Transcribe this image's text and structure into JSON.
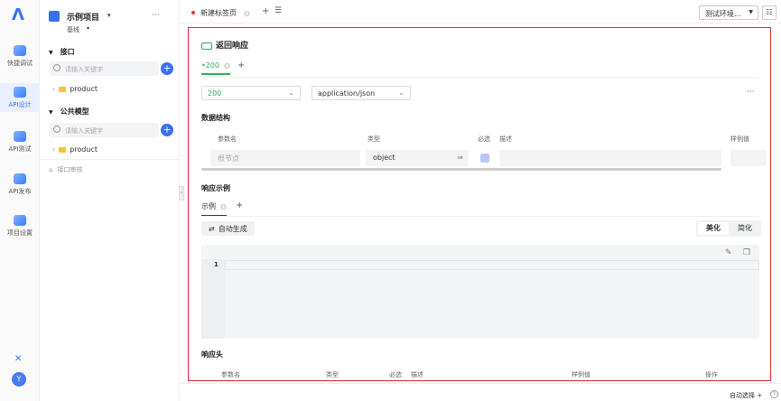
{
  "rail": {
    "items": [
      {
        "label": "快捷调试",
        "icon": "bolt-icon"
      },
      {
        "label": "API设计",
        "icon": "design-icon"
      },
      {
        "label": "API测试",
        "icon": "test-icon"
      },
      {
        "label": "API发布",
        "icon": "publish-icon"
      },
      {
        "label": "项目设置",
        "icon": "settings-icon"
      }
    ],
    "avatar": "Y"
  },
  "sidebar": {
    "project": "示例项目",
    "branch": "基线",
    "more": "···",
    "sections": [
      {
        "title": "接口",
        "placeholder": "请输入关键字",
        "tree_item": "product"
      },
      {
        "title": "公共模型",
        "placeholder": "请输入关键字",
        "tree_item": "product"
      }
    ],
    "review": "接口审核"
  },
  "topbar": {
    "tab": "新建标签页",
    "env": "测试环境..."
  },
  "panel": {
    "title": "返回响应",
    "status_tab": "200",
    "status_select": "200",
    "content_type": "application/json",
    "more": "···",
    "schema_title": "数据结构",
    "headers": [
      "参数名",
      "类型",
      "必选",
      "描述",
      "样例值"
    ],
    "row": {
      "name_placeholder": "根节点",
      "type": "object"
    },
    "example_title": "响应示例",
    "example_tab": "示例",
    "auto_gen": "自动生成",
    "beautify": "美化",
    "simplify": "简化",
    "line_no": "1",
    "resp_header_title": "响应头",
    "resp_headers": [
      "参数名",
      "类型",
      "必选",
      "描述",
      "样例值",
      "操作"
    ]
  },
  "bottom": {
    "auto_select": "自动选择"
  }
}
